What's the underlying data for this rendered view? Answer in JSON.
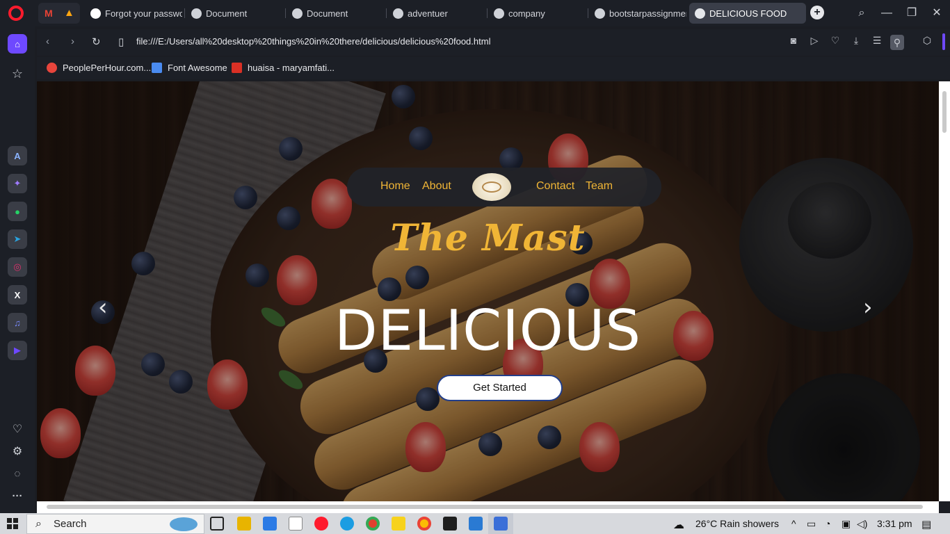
{
  "tabs": [
    {
      "label": "Forgot your password",
      "icon": "github-icon"
    },
    {
      "label": "Document",
      "icon": "globe-icon"
    },
    {
      "label": "Document",
      "icon": "globe-icon"
    },
    {
      "label": "adventuer",
      "icon": "globe-icon"
    },
    {
      "label": "company",
      "icon": "globe-icon"
    },
    {
      "label": "bootstarpassignment.",
      "icon": "globe-icon"
    },
    {
      "label": "DELICIOUS FOOD",
      "icon": "globe-icon",
      "active": true
    }
  ],
  "address": {
    "url": "file:///E:/Users/all%20desktop%20things%20in%20there/delicious/delicious%20food.html"
  },
  "bookmarks": [
    {
      "label": "PeoplePerHour.com...",
      "color": "#e8453c"
    },
    {
      "label": "Font Awesome",
      "color": "#4a8bf0"
    },
    {
      "label": "huaisa - maryamfati...",
      "color": "#d93025"
    }
  ],
  "site": {
    "nav": {
      "home": "Home",
      "about": "About",
      "contact": "Contact",
      "team": "Team"
    },
    "script_title": "The Mast",
    "hero_title": "DELICIOUS",
    "cta": "Get Started",
    "prev": "‹",
    "next": "›"
  },
  "taskbar": {
    "search": "Search",
    "weather": "26°C  Rain showers",
    "time": "3:31 pm"
  },
  "colors": {
    "accent": "#f0b536",
    "opera_red": "#ff1b2d",
    "sidebar_active": "#6e49ff"
  }
}
